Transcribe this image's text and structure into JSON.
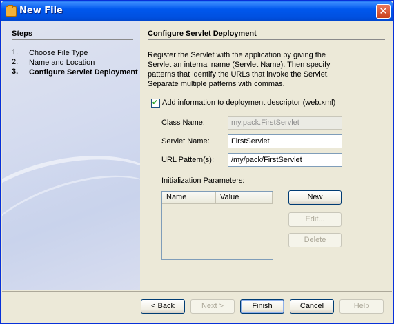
{
  "window": {
    "title": "New File",
    "close_label": "✕"
  },
  "steps": {
    "heading": "Steps",
    "items": [
      {
        "num": "1.",
        "label": "Choose File Type",
        "current": false
      },
      {
        "num": "2.",
        "label": "Name and Location",
        "current": false
      },
      {
        "num": "3.",
        "label": "Configure Servlet Deployment",
        "current": true
      }
    ]
  },
  "main": {
    "heading": "Configure Servlet Deployment",
    "description": "Register the Servlet with the application by giving the Servlet an internal name (Servlet Name). Then specify patterns that identify the URLs that invoke the Servlet. Separate multiple patterns with commas.",
    "checkbox": {
      "label": "Add information to deployment descriptor (web.xml)",
      "checked": true
    },
    "fields": {
      "class_name": {
        "label": "Class Name:",
        "value": "my.pack.FirstServlet",
        "enabled": false
      },
      "servlet_name": {
        "label": "Servlet Name:",
        "value": "FirstServlet",
        "enabled": true
      },
      "url_pattern": {
        "label": "URL Pattern(s):",
        "value": "/my/pack/FirstServlet",
        "enabled": true
      }
    },
    "init_params": {
      "label": "Initialization Parameters:",
      "columns": [
        "Name",
        "Value"
      ],
      "rows": []
    },
    "param_buttons": {
      "new": "New",
      "edit": "Edit...",
      "delete": "Delete"
    }
  },
  "footer": {
    "back": "< Back",
    "next": "Next >",
    "finish": "Finish",
    "cancel": "Cancel",
    "help": "Help"
  },
  "colors": {
    "titlebar": "#0058ee",
    "window_bg": "#ece9d8",
    "steps_bg": "#d4dbef",
    "close_button": "#c8401c"
  },
  "icons": {
    "window": "folder-icon",
    "close": "close-icon",
    "checkbox": "checkmark-icon"
  }
}
